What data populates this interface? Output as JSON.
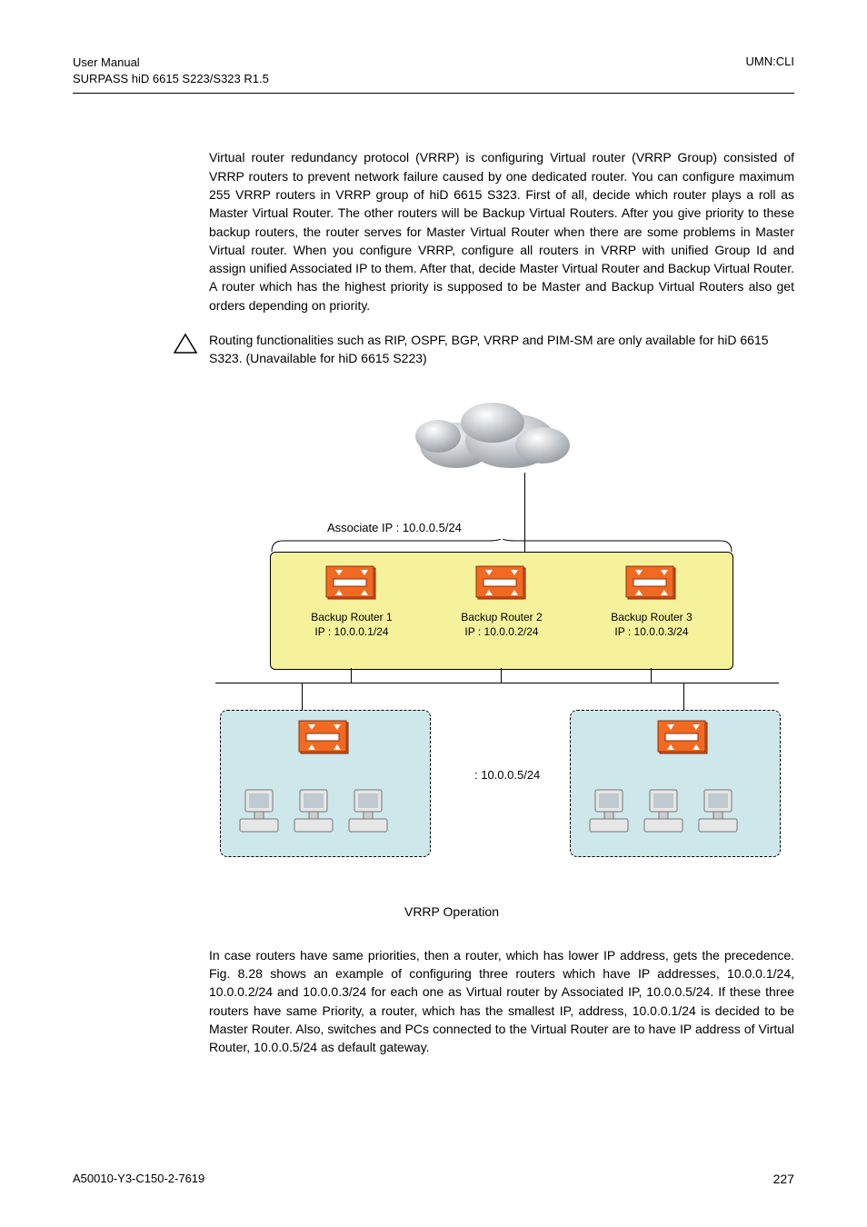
{
  "header": {
    "left_line1": "User Manual",
    "left_line2": "SURPASS hiD 6615 S223/S323 R1.5",
    "right": "UMN:CLI"
  },
  "body": {
    "para1": "Virtual router redundancy protocol (VRRP) is configuring Virtual router (VRRP Group) consisted of VRRP routers to prevent network failure caused by one dedicated router. You can configure maximum 255 VRRP routers in VRRP group of hiD 6615 S323. First of all, decide which router plays a roll as Master Virtual Router. The other routers will be Backup Virtual Routers. After you give priority to these backup routers, the router serves for Master Virtual Router when there are some problems in Master Virtual router. When you configure VRRP, configure all routers in VRRP with unified Group Id and assign unified Associated IP to them. After that, decide Master Virtual Router and Backup Virtual Router. A router which has the highest priority is supposed to be Master and Backup Virtual Routers also get orders depending on priority.",
    "note": "Routing functionalities such as RIP, OSPF, BGP, VRRP and PIM-SM are only available for hiD 6615 S323. (Unavailable for hiD 6615 S223)",
    "para2": "In case routers have same priorities, then a router, which has lower IP address, gets the precedence. Fig. 8.28 shows an example of configuring three routers which have IP addresses, 10.0.0.1/24, 10.0.0.2/24 and 10.0.0.3/24 for each one as Virtual router by Associated IP, 10.0.0.5/24. If these three routers have same Priority, a router, which has the smallest IP, address, 10.0.0.1/24 is decided to be Master Router. Also, switches and PCs connected to the Virtual Router are to have IP address of Virtual Router, 10.0.0.5/24 as default gateway."
  },
  "diagram": {
    "assoc_label": "Associate IP : 10.0.0.5/24",
    "routers": [
      {
        "name": "Backup Router 1",
        "ip": "IP : 10.0.0.1/24"
      },
      {
        "name": "Backup Router 2",
        "ip": "IP : 10.0.0.2/24"
      },
      {
        "name": "Backup Router 3",
        "ip": "IP : 10.0.0.3/24"
      }
    ],
    "mid_label": ": 10.0.0.5/24",
    "caption": "VRRP Operation"
  },
  "footer": {
    "left": "A50010-Y3-C150-2-7619",
    "page": "227"
  }
}
